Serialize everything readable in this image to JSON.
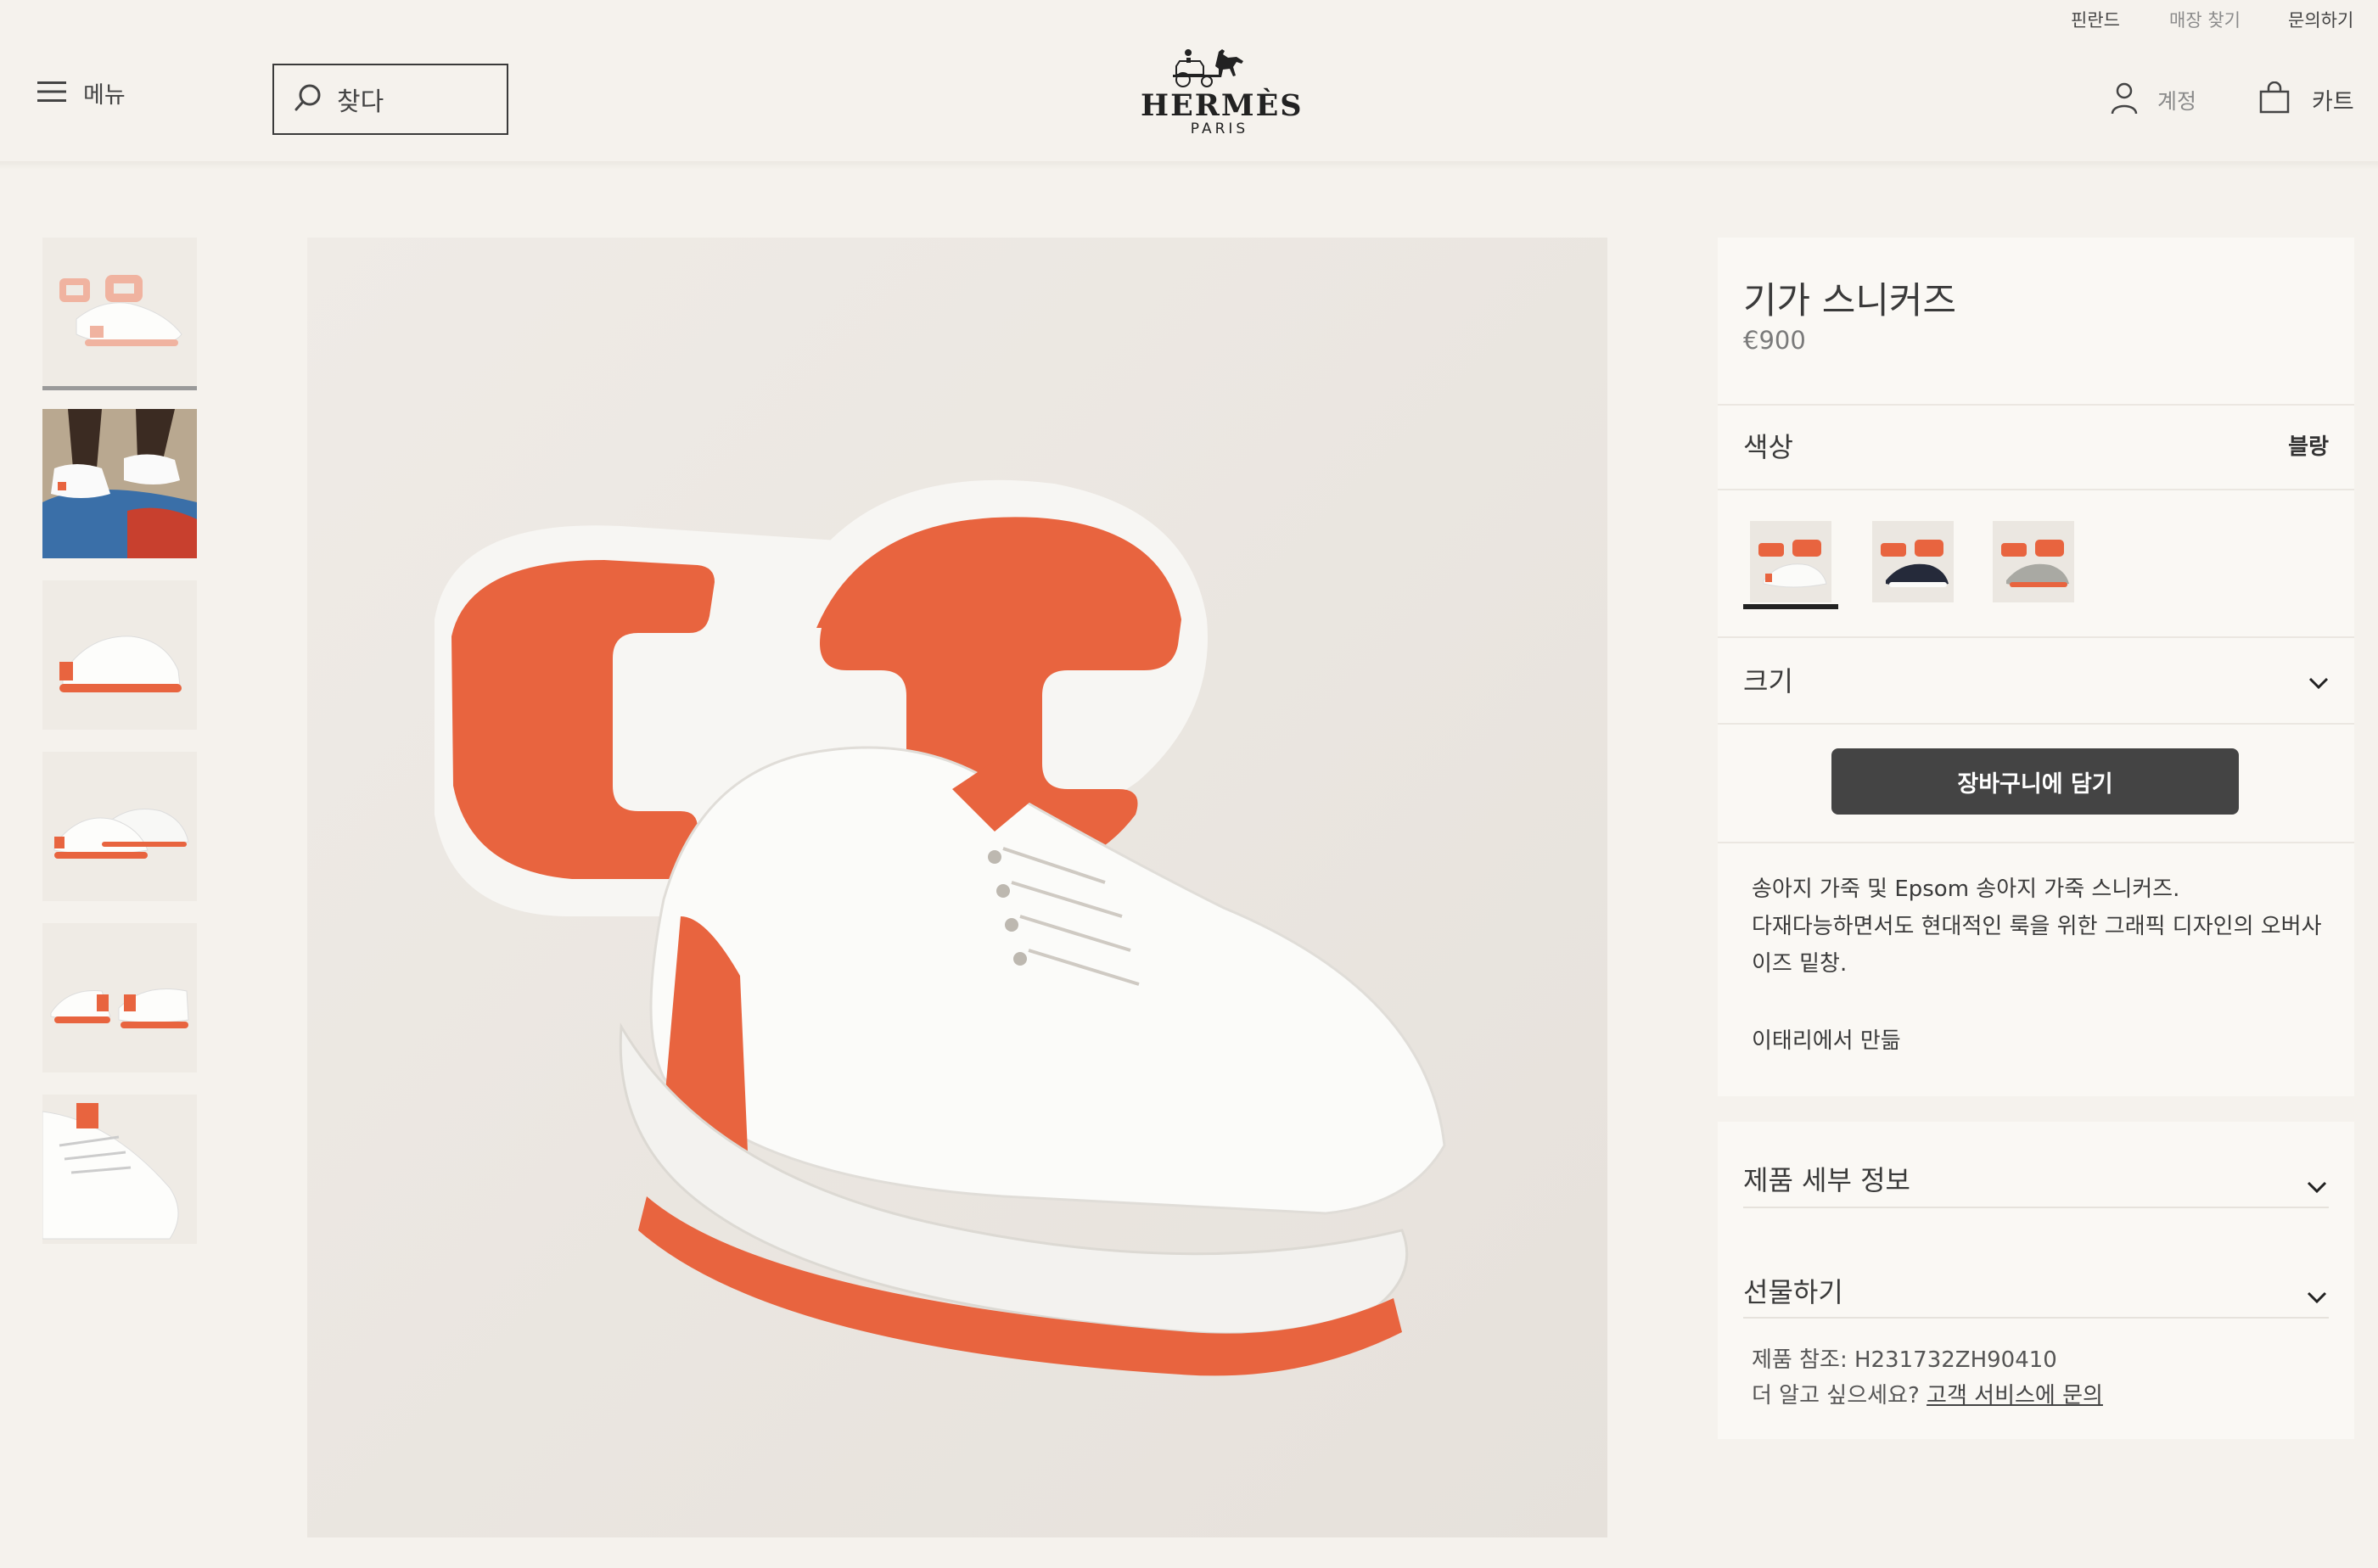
{
  "utility_bar": {
    "country": "핀란드",
    "store_finder": "매장 찾기",
    "contact": "문의하기"
  },
  "header": {
    "menu_label": "메뉴",
    "search_label": "찾다",
    "logo_word": "HERMÈS",
    "logo_city": "PARIS",
    "account_label": "계정",
    "cart_label": "카트"
  },
  "icons": {
    "menu": "hamburger-icon",
    "search": "search-icon",
    "account": "user-icon",
    "cart": "shopping-bag-icon",
    "accordion": "chevron-down-icon"
  },
  "gallery": {
    "thumbnail_count": 6,
    "active_index": 0
  },
  "product": {
    "title": "기가 스니커즈",
    "price": "€900",
    "color_label": "색상",
    "color_value": "블랑",
    "color_swatch_count": 3,
    "selected_swatch_index": 0,
    "size_label": "크기",
    "add_to_cart": "장바구니에 담기",
    "description_line1": "송아지 가죽 및 Epsom 송아지 가죽 스니커즈.",
    "description_line2": "다재다능하면서도 현대적인 룩을 위한 그래픽 디자인의 오버사이즈 밑창.",
    "made_in": "이태리에서 만듦"
  },
  "details": {
    "product_details_label": "제품 세부 정보",
    "gift_label": "선물하기",
    "reference": "제품 참조: H231732ZH90410",
    "more_prefix": "더 알고 싶으세요?",
    "more_link": "고객 서비스에 문의"
  },
  "colors": {
    "background": "#f5f2ed",
    "panel": "#faf8f4",
    "button": "#444444",
    "accent_orange": "#e8643f"
  }
}
